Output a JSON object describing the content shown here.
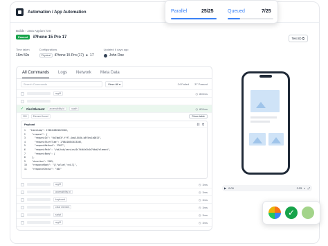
{
  "header": {
    "title": "Automation / App Automation"
  },
  "breadcrumb": {
    "text": "Builds  ›  Java Appium iOS"
  },
  "build": {
    "status": "Passed",
    "name": "iPhone 15 Pro 17"
  },
  "testid": {
    "label": "Test ID"
  },
  "meta": {
    "time_label": "Time taken",
    "time_val": "16m 59s",
    "config_label": "Configurations",
    "config_pill": "Physical",
    "config_device": "iPhone 15 Pro (17)",
    "config_os": "17",
    "updated_label": "Updated 6 days ago",
    "updated_user": "John Doe"
  },
  "tabs": [
    "All Commands",
    "Logs",
    "Network",
    "Meta Data"
  ],
  "filters": {
    "search_placeholder": "Search Commands",
    "view": "View: All",
    "failed": "24 Failed",
    "passed": "37 Passed"
  },
  "commands": [
    {
      "tag": "appR",
      "time": "803ms"
    },
    {
      "tag": "",
      "time": ""
    },
    {
      "name": "Find Element",
      "tag": "accessibility id",
      "tag2": "xpath",
      "time": "803ms"
    }
  ],
  "subrow": {
    "a": "200",
    "b": "Element found",
    "action": "Show table"
  },
  "payload": {
    "title": "Payload",
    "lines": [
      "1   \"timestamp\": 1708416851623106,",
      "2     \"request\": {",
      "3       \"requestId\": \"da7ab03f-fff7-4aa8-8b3b-b8f5ea1b0013\",",
      "4       \"requestStartTime\": 1708416851623106,",
      "5       \"requestMethod\": \"POST\",",
      "6       \"requestPath\": \"/wd/hub/session/0c7d4b2e2b4d7d4a6/element\",",
      "7       \"requestBody\": {",
      "8     },",
      "9     \"duration\": 2285,",
      "10    \"responseBody\": \"{\\\"value\\\":null}\",",
      "11    \"responseStatus\": \"404\""
    ]
  },
  "more_rows": [
    {
      "tag": "appR",
      "time": "3ms"
    },
    {
      "tag": "accessibility id",
      "time": "3ms"
    },
    {
      "tag": "keyboard",
      "time": "3ms"
    },
    {
      "tag": "clear element",
      "time": "3ms"
    },
    {
      "tag": "script",
      "time": "3ms"
    },
    {
      "tag": "appR",
      "time": "3ms"
    }
  ],
  "audio": {
    "start": "0:00",
    "end": "2:25"
  },
  "stats": {
    "parallel_label": "Parallel",
    "parallel_val": "25/25",
    "parallel_fill": 1.0,
    "queued_label": "Queued",
    "queued_val": "7/25",
    "queued_fill": 0.28
  },
  "colors": {
    "accent": "#3b82f6",
    "pass": "#16a34a"
  }
}
